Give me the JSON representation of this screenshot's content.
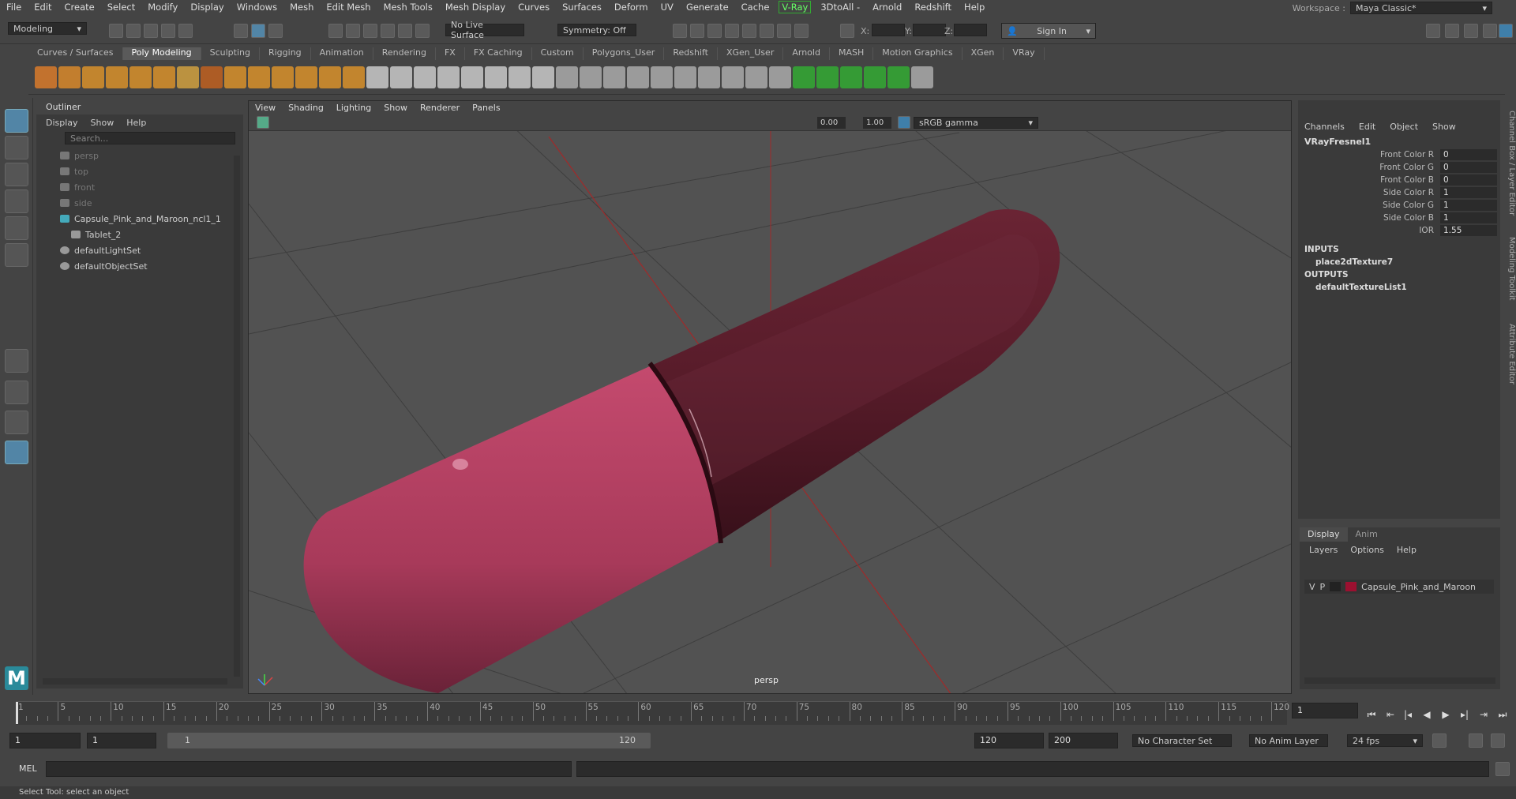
{
  "menubar": {
    "items": [
      "File",
      "Edit",
      "Create",
      "Select",
      "Modify",
      "Display",
      "Windows",
      "Mesh",
      "Edit Mesh",
      "Mesh Tools",
      "Mesh Display",
      "Curves",
      "Surfaces",
      "Deform",
      "UV",
      "Generate",
      "Cache"
    ],
    "vray": "V-Ray",
    "items2": [
      "3DtoAll -",
      "Arnold",
      "Redshift",
      "Help"
    ],
    "workspace_label": "Workspace :",
    "workspace_value": "Maya Classic*"
  },
  "statusline": {
    "mode": "Modeling",
    "live_surface": "No Live Surface",
    "symmetry": "Symmetry: Off",
    "x_label": "X:",
    "y_label": "Y:",
    "z_label": "Z:",
    "sign_in": "Sign In"
  },
  "shelf_tabs": [
    "Curves / Surfaces",
    "Poly Modeling",
    "Sculpting",
    "Rigging",
    "Animation",
    "Rendering",
    "FX",
    "FX Caching",
    "Custom",
    "Polygons_User",
    "Redshift",
    "XGen_User",
    "Arnold",
    "MASH",
    "Motion Graphics",
    "XGen",
    "VRay"
  ],
  "shelf_active": "Poly Modeling",
  "outliner": {
    "title": "Outliner",
    "menu": [
      "Display",
      "Show",
      "Help"
    ],
    "search_placeholder": "Search...",
    "items": [
      {
        "label": "persp",
        "dim": true
      },
      {
        "label": "top",
        "dim": true
      },
      {
        "label": "front",
        "dim": true
      },
      {
        "label": "side",
        "dim": true
      },
      {
        "label": "Capsule_Pink_and_Maroon_ncl1_1",
        "dim": false
      },
      {
        "label": "Tablet_2",
        "dim": false
      },
      {
        "label": "defaultLightSet",
        "dim": false
      },
      {
        "label": "defaultObjectSet",
        "dim": false
      }
    ]
  },
  "viewport": {
    "menu": [
      "View",
      "Shading",
      "Lighting",
      "Show",
      "Renderer",
      "Panels"
    ],
    "exposure": "0.00",
    "gamma": "1.00",
    "colorspace": "sRGB gamma",
    "camera": "persp"
  },
  "channel_box": {
    "menu": [
      "Channels",
      "Edit",
      "Object",
      "Show"
    ],
    "node": "VRayFresnel1",
    "attrs": [
      {
        "name": "Front Color R",
        "value": "0"
      },
      {
        "name": "Front Color G",
        "value": "0"
      },
      {
        "name": "Front Color B",
        "value": "0"
      },
      {
        "name": "Side Color R",
        "value": "1"
      },
      {
        "name": "Side Color G",
        "value": "1"
      },
      {
        "name": "Side Color B",
        "value": "1"
      },
      {
        "name": "IOR",
        "value": "1.55"
      }
    ],
    "inputs_label": "INPUTS",
    "input_node": "place2dTexture7",
    "outputs_label": "OUTPUTS",
    "output_node": "defaultTextureList1"
  },
  "layers": {
    "tabs": [
      "Display",
      "Anim"
    ],
    "menu": [
      "Layers",
      "Options",
      "Help"
    ],
    "row": {
      "v": "V",
      "p": "P",
      "name": "Capsule_Pink_and_Maroon",
      "color": "#9b1030"
    }
  },
  "side_tabs": [
    "Channel Box / Layer Editor",
    "Modeling Toolkit",
    "Attribute Editor"
  ],
  "timeline": {
    "ticks": [
      "1",
      "5",
      "10",
      "15",
      "20",
      "25",
      "30",
      "35",
      "40",
      "45",
      "50",
      "55",
      "60",
      "65",
      "70",
      "75",
      "80",
      "85",
      "90",
      "95",
      "100",
      "105",
      "110",
      "115",
      "120"
    ],
    "current_frame": "1"
  },
  "range": {
    "start": "1",
    "playback_start": "1",
    "slider_start": "1",
    "slider_end": "120",
    "playback_end": "120",
    "end": "200",
    "char_set": "No Character Set",
    "anim_layer": "No Anim Layer",
    "fps": "24 fps"
  },
  "mel": {
    "label": "MEL"
  },
  "help_line": "Select Tool: select an object",
  "colors": {
    "capsule_pink": "#b43a5e",
    "capsule_maroon": "#5a1c2a"
  }
}
